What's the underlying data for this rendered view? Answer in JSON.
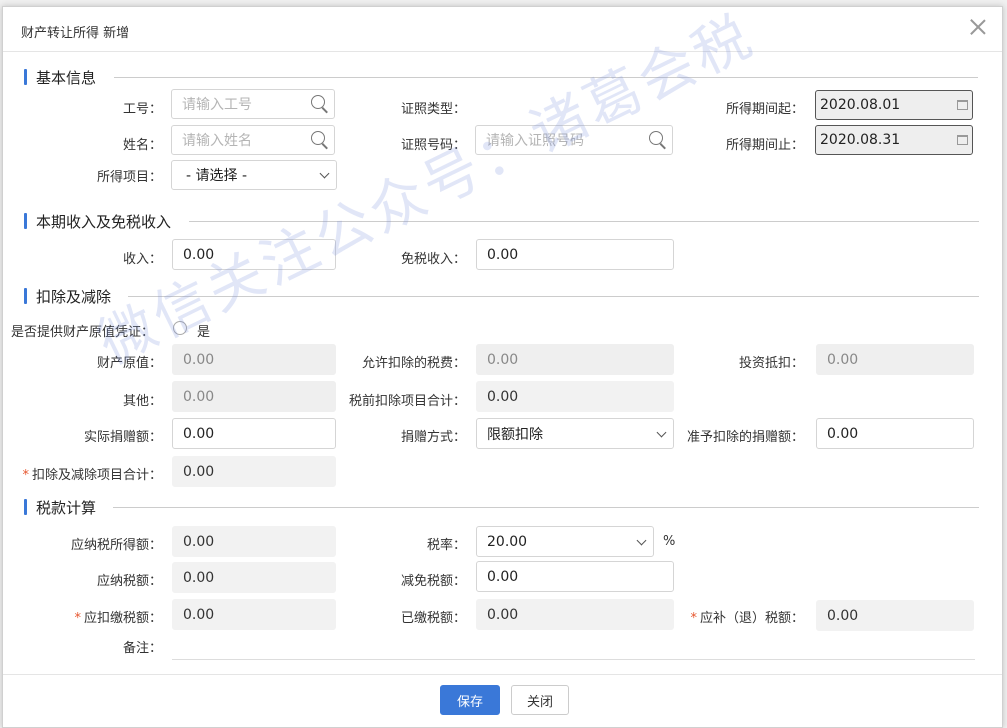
{
  "dialog": {
    "title": "财产转让所得 新增"
  },
  "sections": {
    "basic": "基本信息",
    "income": "本期收入及免税收入",
    "deduction": "扣除及减除",
    "tax": "税款计算"
  },
  "basic": {
    "employee_no_label": "工号：",
    "employee_no_placeholder": "请输入工号",
    "name_label": "姓名：",
    "name_placeholder": "请输入姓名",
    "income_item_label": "所得项目：",
    "income_item_value": "- 请选择 -",
    "id_type_label": "证照类型：",
    "id_no_label": "证照号码：",
    "id_no_placeholder": "请输入证照号码",
    "period_start_label": "所得期间起：",
    "period_start_value": "2020.08.01",
    "period_end_label": "所得期间止：",
    "period_end_value": "2020.08.31"
  },
  "income": {
    "income_label": "收入：",
    "income_value": "0.00",
    "exempt_label": "免税收入：",
    "exempt_value": "0.00"
  },
  "deduction": {
    "voucher_label": "是否提供财产原值凭证：",
    "voucher_option": "是",
    "original_value_label": "财产原值：",
    "original_value": "0.00",
    "allowed_tax_label": "允许扣除的税费：",
    "allowed_tax_value": "0.00",
    "investment_label": "投资抵扣：",
    "investment_value": "0.00",
    "other_label": "其他：",
    "other_value": "0.00",
    "pretax_total_label": "税前扣除项目合计：",
    "pretax_total_value": "0.00",
    "donation_label": "实际捐赠额：",
    "donation_value": "0.00",
    "donation_method_label": "捐赠方式：",
    "donation_method_value": "限额扣除",
    "allowed_donation_label": "准予扣除的捐赠额：",
    "allowed_donation_value": "0.00",
    "total_label": "扣除及减除项目合计：",
    "total_value": "0.00"
  },
  "tax": {
    "taxable_income_label": "应纳税所得额：",
    "taxable_income_value": "0.00",
    "rate_label": "税率：",
    "rate_value": "20.00",
    "rate_unit": "%",
    "tax_payable_label": "应纳税额：",
    "tax_payable_value": "0.00",
    "reduction_label": "减免税额：",
    "reduction_value": "0.00",
    "withhold_label": "应扣缴税额：",
    "withhold_value": "0.00",
    "paid_label": "已缴税额：",
    "paid_value": "0.00",
    "refund_label": "应补（退）税额：",
    "refund_value": "0.00",
    "note_label": "备注："
  },
  "buttons": {
    "save": "保存",
    "close": "关闭"
  },
  "watermark": "微信关注公众号：诸葛会税",
  "colors": {
    "accent": "#3a78d8",
    "required": "#e6552d"
  }
}
